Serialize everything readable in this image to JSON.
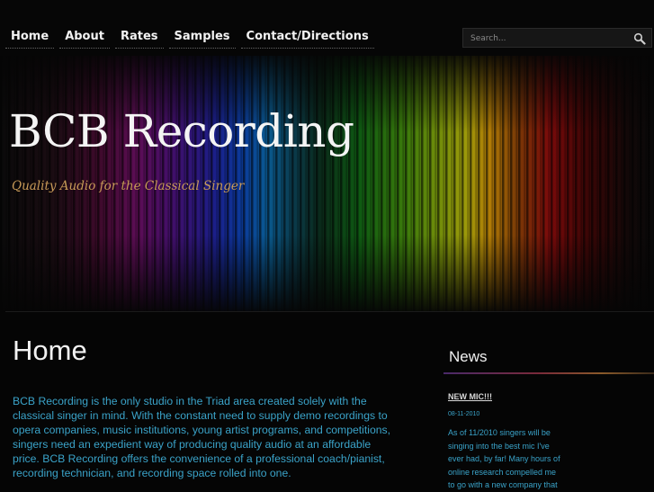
{
  "nav": {
    "items": [
      "Home",
      "About",
      "Rates",
      "Samples",
      "Contact/Directions"
    ]
  },
  "search": {
    "placeholder": "Search..."
  },
  "header": {
    "site_title": "BCB Recording",
    "tagline": "Quality Audio for the Classical Singer"
  },
  "main": {
    "title": "Home",
    "intro": "BCB Recording is the only studio in the Triad area created solely with the classical singer in mind. With the constant need to supply demo recordings to opera companies, music institutions, young artist programs, and competitions, singers need an expedient way of producing quality audio at an affordable price. BCB Recording offers the convenience of a professional coach/pianist, recording technician, and recording space rolled into one."
  },
  "sidebar": {
    "title": "News",
    "post": {
      "title": "NEW MIC!!!",
      "date": "08-11-2010",
      "excerpt": "As of 11/2010 singers will be singing into the best mic I've ever had, by far! Many hours of online research compelled me to go with a new company that"
    }
  },
  "colors": {
    "link_text": "#3aa3c9",
    "tagline": "#c99b58",
    "background": "#050505"
  },
  "icons": {
    "search": "magnifier-icon"
  }
}
